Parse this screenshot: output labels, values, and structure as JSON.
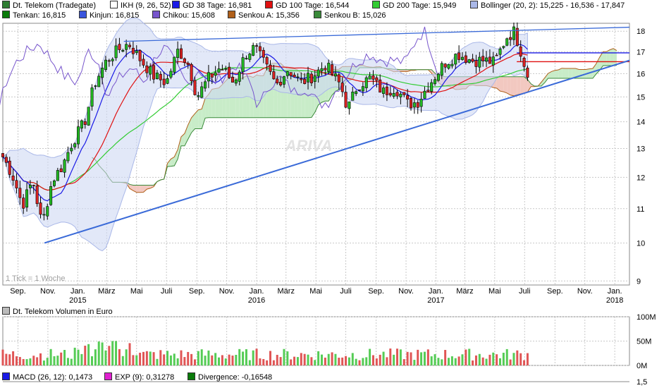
{
  "legend_main_row1": [
    {
      "label": "Dt. Telekom (Tradegate)",
      "color": "#2e7d32"
    },
    {
      "label": "IKH (9, 26, 52)",
      "color": "#ffffff"
    },
    {
      "label": "GD 38 Tage: 16,981",
      "color": "#1a1ae6"
    },
    {
      "label": "GD 100 Tage: 16,544",
      "color": "#e01010"
    },
    {
      "label": "GD 200 Tage: 15,949",
      "color": "#33cc33"
    },
    {
      "label": "Bollinger (20, 2): 15,225 - 16,536 - 17,847",
      "color": "#aab8e8"
    }
  ],
  "legend_main_row2": [
    {
      "label": "Tenkan: 16,815",
      "color": "#0a7a0a"
    },
    {
      "label": "Kinjun: 16,815",
      "color": "#3a55dd"
    },
    {
      "label": "Chikou: 15,608",
      "color": "#7755cc"
    },
    {
      "label": "Senkou A: 15,356",
      "color": "#b0601a"
    },
    {
      "label": "Senkou B: 15,026",
      "color": "#3a8a3a"
    }
  ],
  "legend_volume": [
    {
      "label": "Dt. Telekom Volumen in Euro",
      "color": "#bbbbbb"
    }
  ],
  "legend_macd": [
    {
      "label": "MACD (26, 12): 0,1473",
      "color": "#1a1ae6"
    },
    {
      "label": "EXP (9): 0,31278",
      "color": "#e020d0"
    },
    {
      "label": "Divergence: -0,16548",
      "color": "#0a7a0a"
    }
  ],
  "tick_note": "1 Tick = 1 Woche",
  "watermark": "ARIVA",
  "colors": {
    "up": "#22bb22",
    "down": "#dd2222",
    "grid": "#c8c8c8",
    "cloud_up": "#c8ecc8",
    "cloud_down": "#f2c8c0",
    "bollinger_fill": "#cfd8f3"
  },
  "chart_data": [
    {
      "type": "line",
      "title": "Dt. Telekom (Tradegate)",
      "description_of_series": "weekly candlesticks with moving averages, Bollinger bands, Ichimoku cloud and trendlines",
      "yticks": [
        9,
        10,
        11,
        12,
        13,
        14,
        15,
        16,
        17,
        18
      ],
      "ylim": [
        8.9,
        18.4
      ],
      "y_scale": "log",
      "xlim": [
        "2014-08-01",
        "2018-01-31"
      ],
      "x_ticks": [
        {
          "date": "2014-09-01",
          "label": "Sep."
        },
        {
          "date": "2014-11-01",
          "label": "Nov."
        },
        {
          "date": "2015-01-01",
          "label": "Jan.",
          "year": "2015"
        },
        {
          "date": "2015-03-01",
          "label": "März"
        },
        {
          "date": "2015-05-01",
          "label": "Mai"
        },
        {
          "date": "2015-07-01",
          "label": "Juli"
        },
        {
          "date": "2015-09-01",
          "label": "Sep."
        },
        {
          "date": "2015-11-01",
          "label": "Nov."
        },
        {
          "date": "2016-01-01",
          "label": "Jan.",
          "year": "2016"
        },
        {
          "date": "2016-03-01",
          "label": "März"
        },
        {
          "date": "2016-05-01",
          "label": "Mai"
        },
        {
          "date": "2016-07-01",
          "label": "Juli"
        },
        {
          "date": "2016-09-01",
          "label": "Sep."
        },
        {
          "date": "2016-11-01",
          "label": "Nov."
        },
        {
          "date": "2017-01-01",
          "label": "Jan.",
          "year": "2017"
        },
        {
          "date": "2017-03-01",
          "label": "März"
        },
        {
          "date": "2017-05-01",
          "label": "Mai"
        },
        {
          "date": "2017-07-01",
          "label": "Juli"
        },
        {
          "date": "2017-09-01",
          "label": "Sep."
        },
        {
          "date": "2017-11-01",
          "label": "Nov."
        },
        {
          "date": "2018-01-01",
          "label": "Jan.",
          "year": "2018"
        }
      ],
      "price_anchors": [
        [
          "2014-08-01",
          12.7
        ],
        [
          "2014-08-20",
          12.1
        ],
        [
          "2014-09-10",
          11.1
        ],
        [
          "2014-10-01",
          11.9
        ],
        [
          "2014-10-20",
          10.5
        ],
        [
          "2014-11-10",
          11.9
        ],
        [
          "2014-12-01",
          12.4
        ],
        [
          "2014-12-20",
          13.2
        ],
        [
          "2015-01-15",
          14.0
        ],
        [
          "2015-02-05",
          15.6
        ],
        [
          "2015-03-01",
          16.6
        ],
        [
          "2015-03-25",
          17.1
        ],
        [
          "2015-04-15",
          17.4
        ],
        [
          "2015-05-10",
          16.6
        ],
        [
          "2015-06-05",
          15.9
        ],
        [
          "2015-07-01",
          15.6
        ],
        [
          "2015-07-25",
          17.1
        ],
        [
          "2015-08-15",
          16.4
        ],
        [
          "2015-09-01",
          15.0
        ],
        [
          "2015-09-25",
          15.8
        ],
        [
          "2015-10-20",
          16.3
        ],
        [
          "2015-11-15",
          15.6
        ],
        [
          "2015-12-10",
          16.9
        ],
        [
          "2015-12-28",
          17.2
        ],
        [
          "2016-01-20",
          16.3
        ],
        [
          "2016-02-10",
          15.5
        ],
        [
          "2016-03-05",
          16.2
        ],
        [
          "2016-04-01",
          15.6
        ],
        [
          "2016-04-25",
          15.9
        ],
        [
          "2016-05-20",
          16.4
        ],
        [
          "2016-06-20",
          15.5
        ],
        [
          "2016-07-05",
          14.5
        ],
        [
          "2016-07-25",
          15.5
        ],
        [
          "2016-08-20",
          15.8
        ],
        [
          "2016-09-15",
          15.2
        ],
        [
          "2016-10-10",
          15.4
        ],
        [
          "2016-11-05",
          14.7
        ],
        [
          "2016-11-25",
          14.8
        ],
        [
          "2016-12-20",
          15.6
        ],
        [
          "2017-01-20",
          16.5
        ],
        [
          "2017-02-15",
          16.9
        ],
        [
          "2017-03-15",
          16.6
        ],
        [
          "2017-04-10",
          16.6
        ],
        [
          "2017-05-01",
          16.5
        ],
        [
          "2017-05-25",
          17.7
        ],
        [
          "2017-06-10",
          18.0
        ],
        [
          "2017-06-25",
          16.9
        ],
        [
          "2017-07-10",
          15.7
        ]
      ],
      "volume_axis": {
        "ticks": [
          "0M",
          "50M",
          "100M"
        ],
        "max_millions": 100
      },
      "macd_axis_label": "1,5",
      "trendlines": [
        {
          "from": [
            "2014-10-25",
            10.0
          ],
          "to": [
            "2018-01-31",
            16.6
          ],
          "color": "#3a6ad8"
        },
        {
          "from": [
            "2015-04-05",
            17.5
          ],
          "to": [
            "2018-01-31",
            18.2
          ],
          "color": "#3a6ad8"
        }
      ],
      "horizontal_levels": [
        {
          "from": "2017-06-15",
          "value": 16.95,
          "color": "#1a1ae6"
        },
        {
          "from": "2017-06-15",
          "value": 16.54,
          "color": "#e01010"
        }
      ]
    }
  ]
}
